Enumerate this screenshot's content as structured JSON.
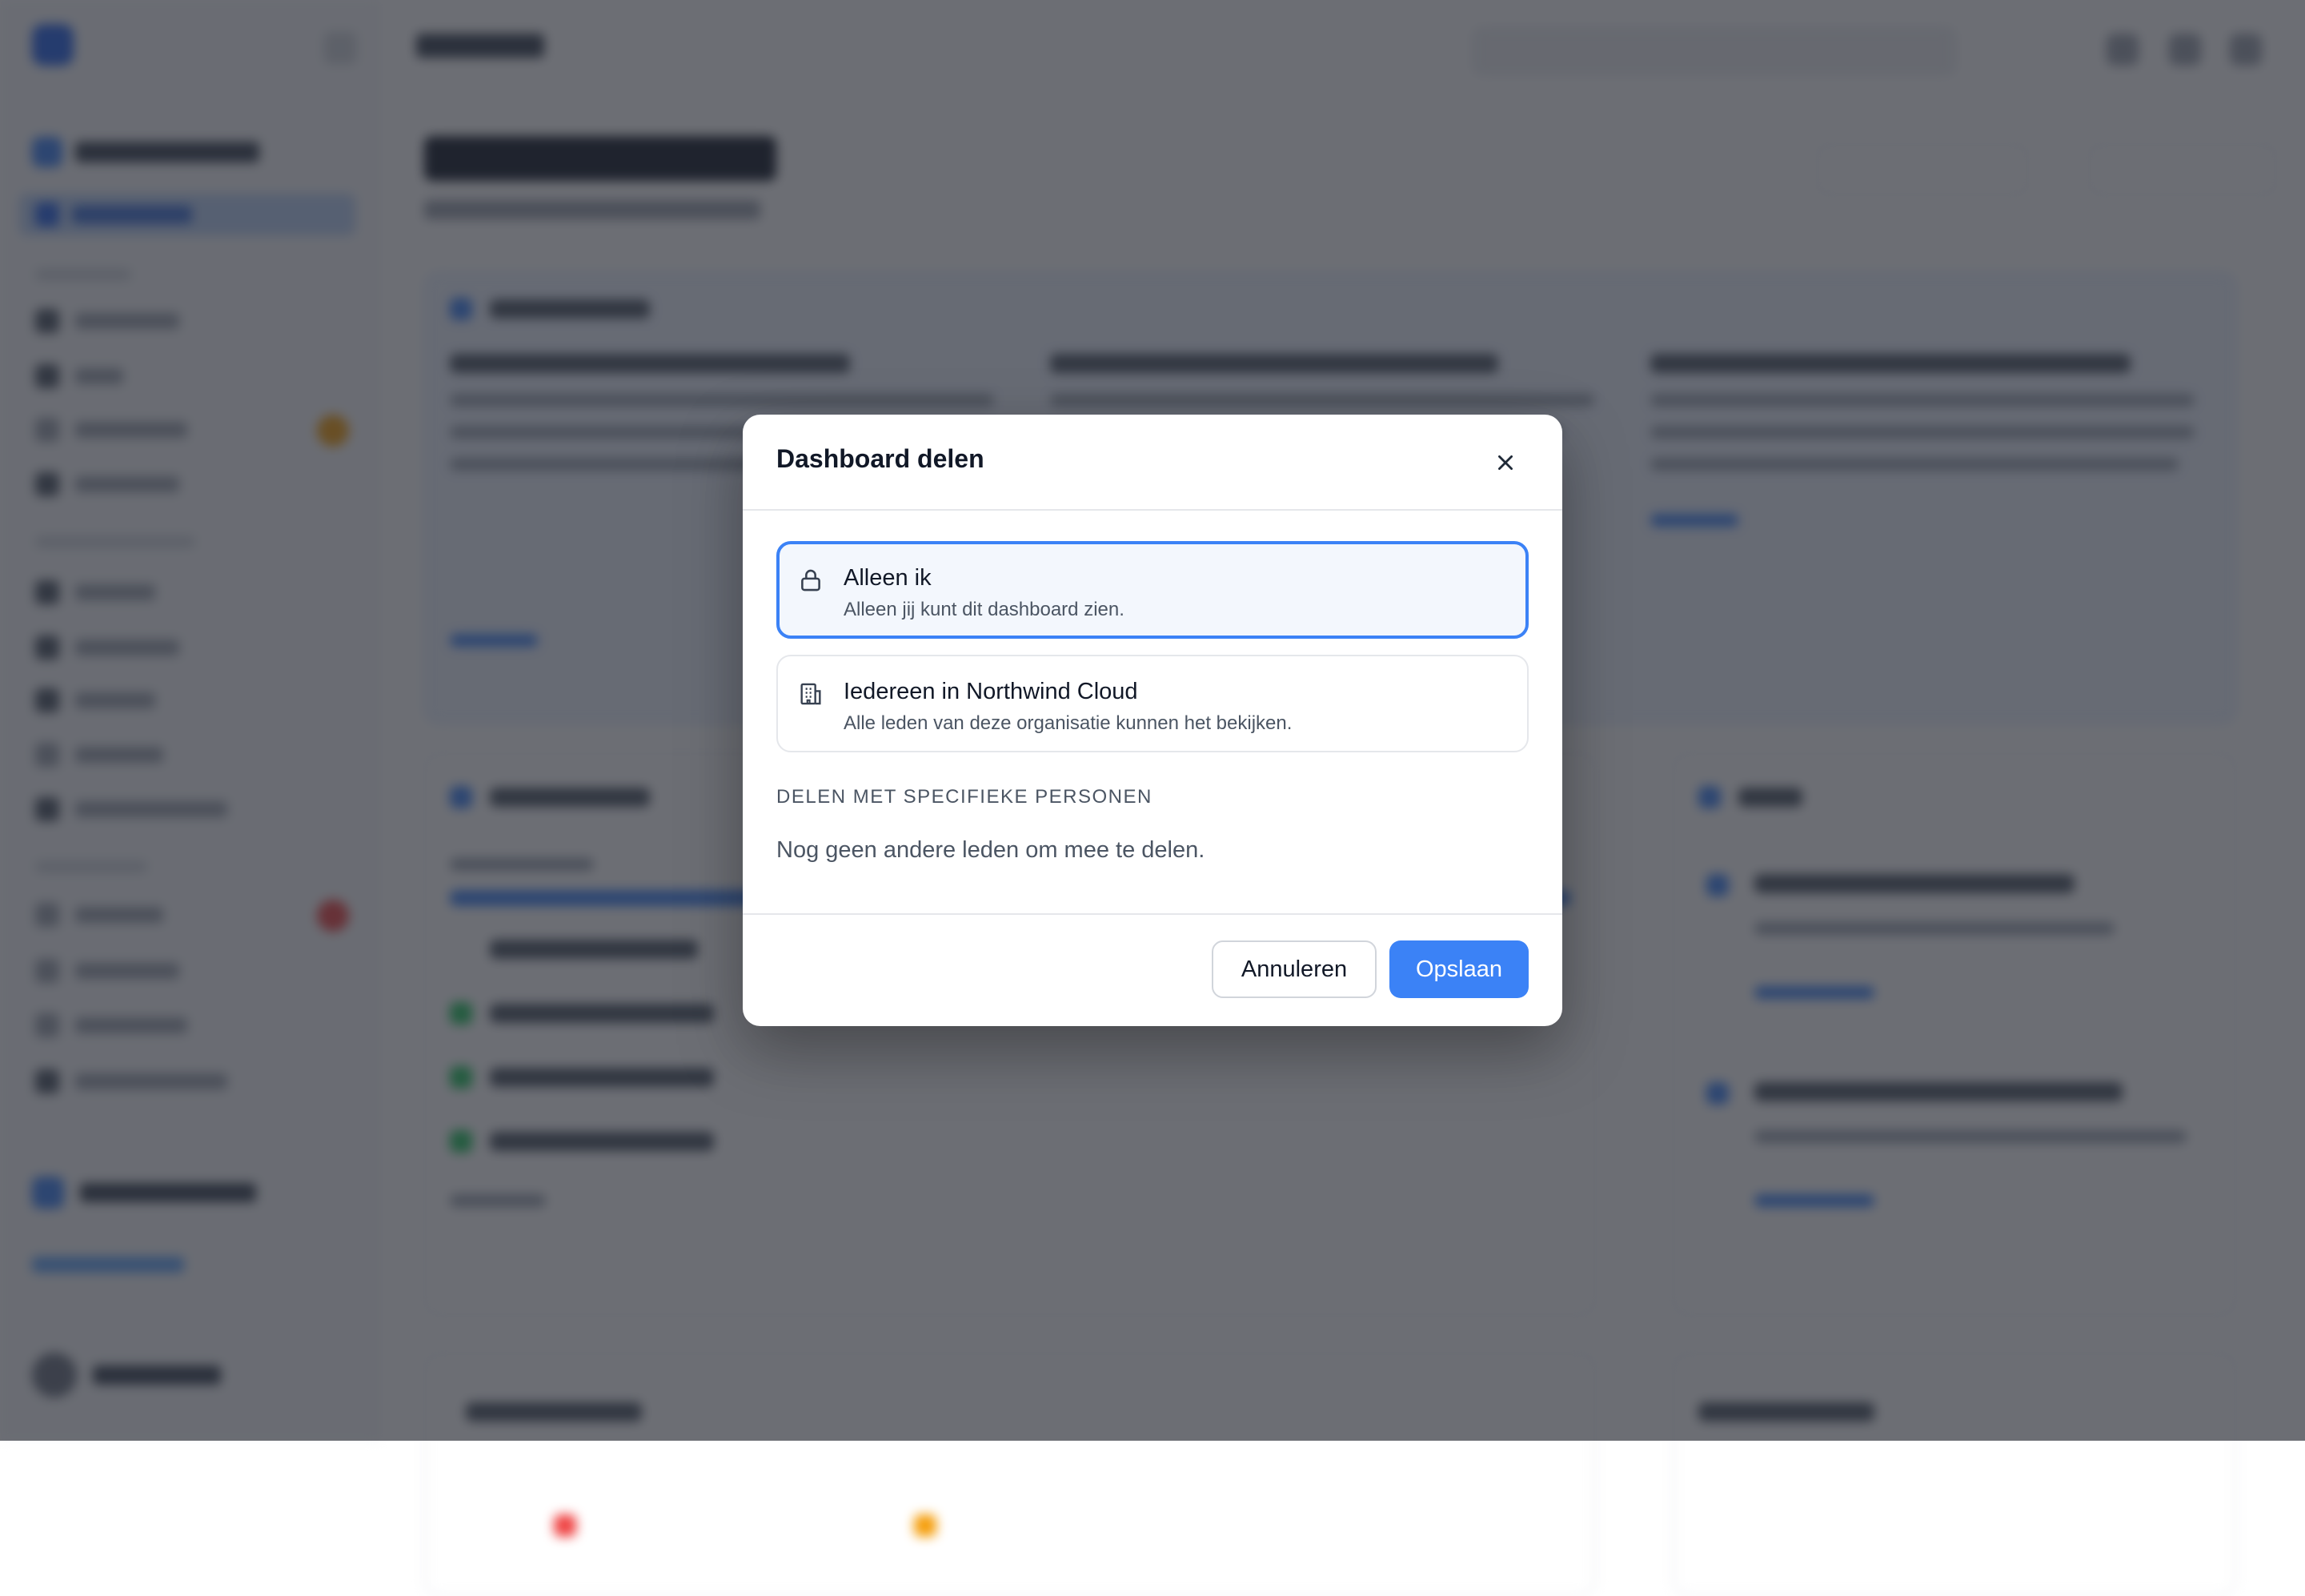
{
  "dialog": {
    "title": "Dashboard delen",
    "options": [
      {
        "title": "Alleen ik",
        "description": "Alleen jij kunt dit dashboard zien.",
        "icon": "lock-icon",
        "selected": true
      },
      {
        "title": "Iedereen in Northwind Cloud",
        "description": "Alle leden van deze organisatie kunnen het bekijken.",
        "icon": "building-icon",
        "selected": false
      }
    ],
    "specific_section_label": "DELEN MET SPECIFIEKE PERSONEN",
    "empty_state": "Nog geen andere leden om mee te delen.",
    "cancel_label": "Annuleren",
    "save_label": "Opslaan",
    "close_icon": "close-icon"
  },
  "colors": {
    "accent": "#3b82f6",
    "selected_bg": "#f3f7fd",
    "backdrop": "rgba(38,42,50,0.68)"
  }
}
